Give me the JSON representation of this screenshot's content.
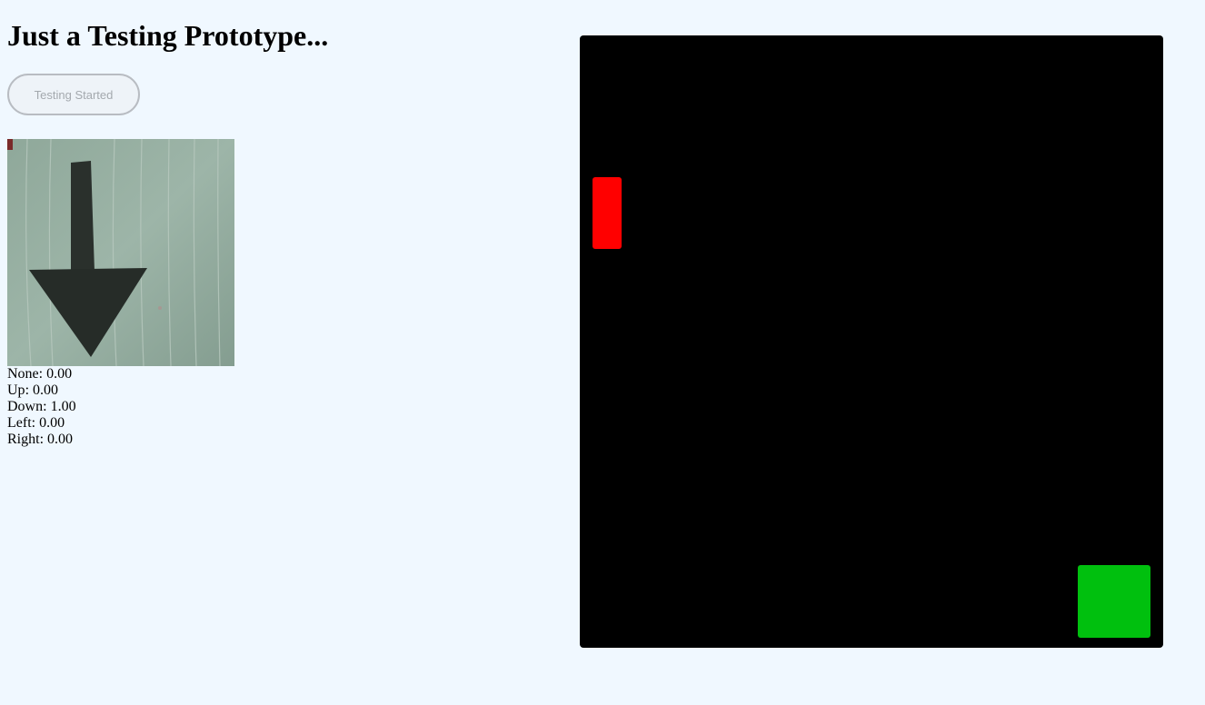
{
  "page": {
    "title": "Just a Testing Prototype..."
  },
  "controls": {
    "status_button_label": "Testing Started"
  },
  "predictions": [
    {
      "label": "None",
      "value": "0.00"
    },
    {
      "label": "Up",
      "value": "0.00"
    },
    {
      "label": "Down",
      "value": "1.00"
    },
    {
      "label": "Left",
      "value": "0.00"
    },
    {
      "label": "Right",
      "value": "0.00"
    }
  ],
  "webcam": {
    "content": "down-arrow drawing"
  },
  "game": {
    "background": "#000000",
    "player_color": "#ff0000",
    "goal_color": "#00c00e"
  }
}
